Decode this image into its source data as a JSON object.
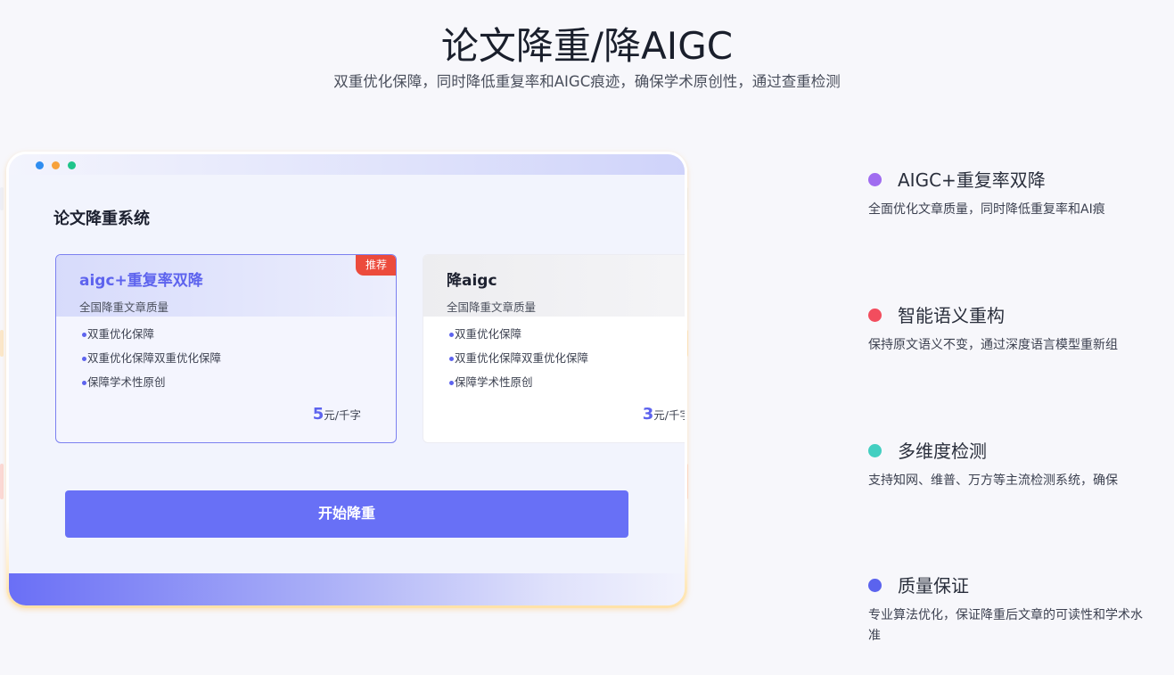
{
  "header": {
    "title": "论文降重/降AIGC",
    "subtitle": "双重优化保障，同时降低重复率和AIGC痕迹，确保学术原创性，通过查重检测"
  },
  "window": {
    "dots": [
      "#2f8df0",
      "#f7a23b",
      "#1fc48a"
    ],
    "system_title": "论文降重系统",
    "cards": [
      {
        "name": "aigc+重复率双降",
        "desc": "全国降重文章质量",
        "badge": "推荐",
        "features": [
          "双重优化保障",
          "双重优化保障双重优化保障",
          "保障学术性原创"
        ],
        "price_value": "5",
        "price_unit": "元/千字",
        "selected": true
      },
      {
        "name": "降aigc",
        "desc": "全国降重文章质量",
        "features": [
          "双重优化保障",
          "双重优化保障双重优化保障",
          "保障学术性原创"
        ],
        "price_value": "3",
        "price_unit": "元/千字",
        "selected": false
      }
    ],
    "start_button": "开始降重"
  },
  "features": [
    {
      "title": "AIGC+重复率双降",
      "desc": "全面优化文章质量，同时降低重复率和AI痕",
      "color": "#a06cf0"
    },
    {
      "title": "智能语义重构",
      "desc": "保持原文语义不变，通过深度语言模型重新组",
      "color": "#f24d5e"
    },
    {
      "title": "多维度检测",
      "desc": "支持知网、维普、万方等主流检测系统，确保",
      "color": "#43cfc1"
    },
    {
      "title": "质量保证",
      "desc": "专业算法优化，保证降重后文章的可读性和学术水准",
      "color": "#5b63ee"
    }
  ]
}
